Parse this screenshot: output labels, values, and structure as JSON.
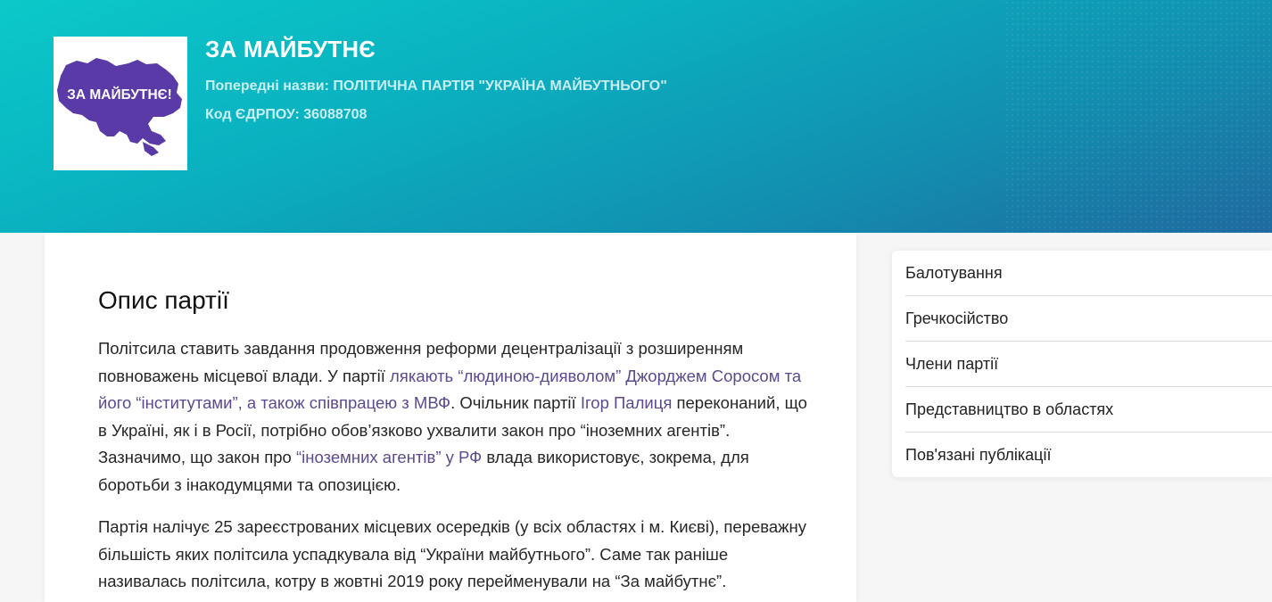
{
  "header": {
    "party_name": "ЗА МАЙБУТНЄ",
    "previous_names": "Попередні назви: ПОЛІТИЧНА ПАРТІЯ \"УКРАЇНА МАЙБУТНЬОГО\"",
    "edrpou": "Код ЄДРПОУ: 36088708",
    "logo_text": "ЗА МАЙБУТНЄ!",
    "logo_color": "#5a3aa6"
  },
  "main": {
    "title": "Опис партії",
    "para1": {
      "t1": "Політсила ставить завдання продовження реформи децентралізації з розширенням повноважень місцевої влади. У партії ",
      "link1": "лякають “людиною-дияволом” Джорджем Соросом та його “інститутами”, а також співпрацею з МВФ",
      "t2": ". Очільник партії ",
      "link2": "Ігор Палиця",
      "t3": " переконаний, що в Україні, як і в Росії, потрібно обов’язково ухвалити закон про “іноземних агентів”. Зазначимо, що закон про ",
      "link3": "“іноземних агентів” у РФ",
      "t4": " влада використовує, зокрема, для боротьби з інакодумцями та опозицією."
    },
    "para2": "Партія налічує 25 зареєстрованих місцевих осередків (у всіх областях і м. Києві), переважну більшість яких політсила успадкувала від “України майбутнього”. Саме так раніше називалась політсила, котру в жовтні 2019 року перейменували на “За майбутнє”."
  },
  "sidebar": {
    "items": [
      {
        "label": "Балотування"
      },
      {
        "label": "Гречкосійство"
      },
      {
        "label": "Члени партії"
      },
      {
        "label": "Представництво в областях"
      },
      {
        "label": "Пов'язані публікації"
      }
    ]
  },
  "colors": {
    "hero_gradient_start": "#0bc9c9",
    "hero_gradient_end": "#1f6aa0",
    "link": "#5d4a8e"
  }
}
